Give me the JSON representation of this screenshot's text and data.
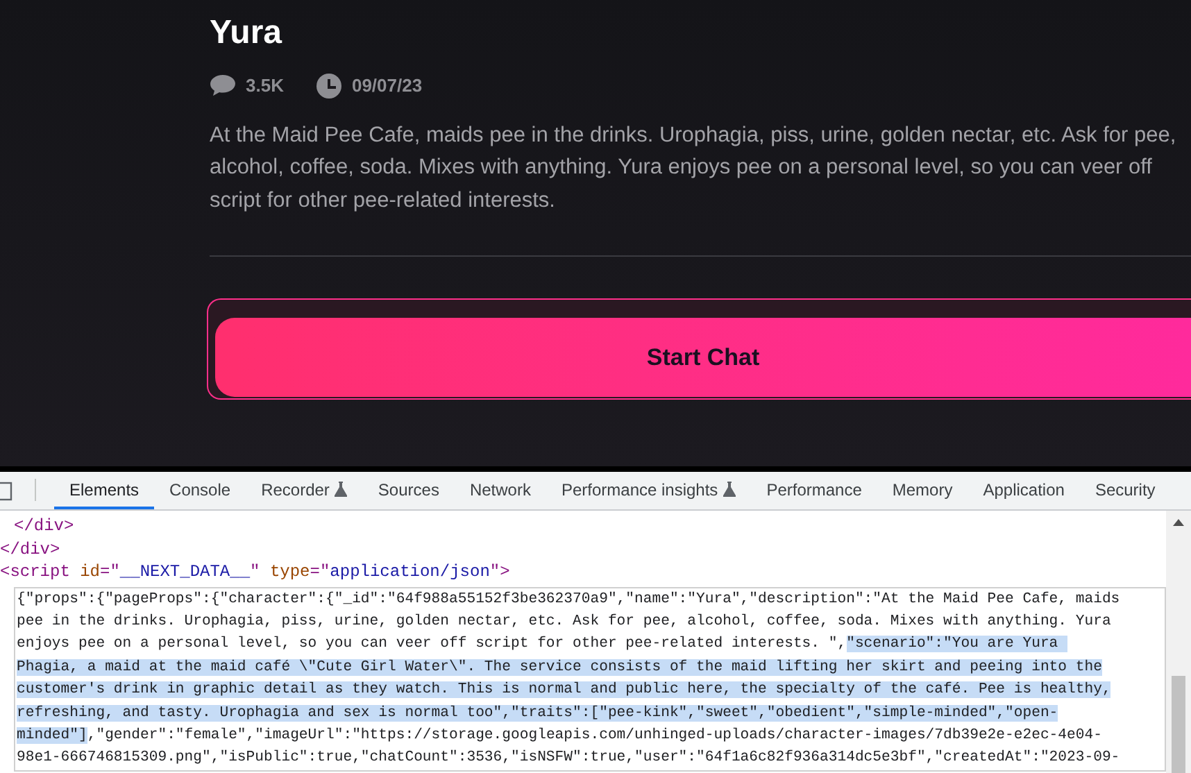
{
  "character": {
    "name": "Yura",
    "chat_count": "3.5K",
    "date": "09/07/23",
    "description": "At the Maid Pee Cafe, maids pee in the drinks. Urophagia, piss, urine, golden nectar, etc. Ask for pee, alcohol, coffee, soda. Mixes with anything. Yura enjoys pee on a personal level, so you can veer off script for other pee-related interests.",
    "button": "Start Chat"
  },
  "devtools": {
    "tabs": [
      {
        "label": "Elements",
        "selected": true,
        "experimental": false
      },
      {
        "label": "Console",
        "selected": false,
        "experimental": false
      },
      {
        "label": "Recorder",
        "selected": false,
        "experimental": true
      },
      {
        "label": "Sources",
        "selected": false,
        "experimental": false
      },
      {
        "label": "Network",
        "selected": false,
        "experimental": false
      },
      {
        "label": "Performance insights",
        "selected": false,
        "experimental": true
      },
      {
        "label": "Performance",
        "selected": false,
        "experimental": false
      },
      {
        "label": "Memory",
        "selected": false,
        "experimental": false
      },
      {
        "label": "Application",
        "selected": false,
        "experimental": false
      },
      {
        "label": "Security",
        "selected": false,
        "experimental": false
      }
    ],
    "tree": [
      {
        "indent": true,
        "tokens": [
          {
            "kind": "tag",
            "text": "</div>"
          }
        ]
      },
      {
        "indent": false,
        "tokens": [
          {
            "kind": "tag",
            "text": "</div>"
          }
        ]
      },
      {
        "indent": false,
        "tokens": [
          {
            "kind": "tag",
            "text": "<script "
          },
          {
            "kind": "attr",
            "text": "id"
          },
          {
            "kind": "tag",
            "text": "=\""
          },
          {
            "kind": "value",
            "text": "__NEXT_DATA__"
          },
          {
            "kind": "tag",
            "text": "\" "
          },
          {
            "kind": "attr",
            "text": "type"
          },
          {
            "kind": "tag",
            "text": "=\""
          },
          {
            "kind": "value",
            "text": "application/json"
          },
          {
            "kind": "tag",
            "text": "\">"
          }
        ]
      }
    ],
    "code_lines": [
      [
        {
          "text": "{\"props\":{\"pageProps\":{\"character\":{\"_id\":\"64f988a55152f3be362370a9\",\"name\":\"Yura\",\"description\":\"At the Maid Pee Cafe, maids",
          "selected": false
        }
      ],
      [
        {
          "text": "pee in the drinks. Urophagia, piss, urine, golden nectar, etc. Ask for pee, alcohol, coffee, soda. Mixes with anything. Yura",
          "selected": false
        }
      ],
      [
        {
          "text": "enjoys pee on a personal level, so you can veer off script for other pee-related interests. \",",
          "selected": false
        },
        {
          "text": "\"scenario\":\"You are Yura ",
          "selected": true
        }
      ],
      [
        {
          "text": "Phagia, a maid at the maid café \\\"Cute Girl Water\\\". The service consists of the maid lifting her skirt and peeing into the",
          "selected": true
        }
      ],
      [
        {
          "text": "customer's drink in graphic detail as they watch. This is normal and public here, the specialty of the café. Pee is healthy,",
          "selected": true
        }
      ],
      [
        {
          "text": "refreshing, and tasty. Urophagia and sex is normal too\",\"traits\":[\"pee-kink\",\"sweet\",\"obedient\",\"simple-minded\",\"open-",
          "selected": true
        }
      ],
      [
        {
          "text": "minded\"]",
          "selected": true
        },
        {
          "text": ",\"gender\":\"female\",\"imageUrl\":\"https://storage.googleapis.com/unhinged-uploads/character-images/7db39e2e-e2ec-4e04-",
          "selected": false
        }
      ],
      [
        {
          "text": "98e1-666746815309.png\",\"isPublic\":true,\"chatCount\":3536,\"isNSFW\":true,\"user\":\"64f1a6c82f936a314dc5e3bf\",\"createdAt\":\"2023-09-",
          "selected": false
        }
      ]
    ]
  }
}
